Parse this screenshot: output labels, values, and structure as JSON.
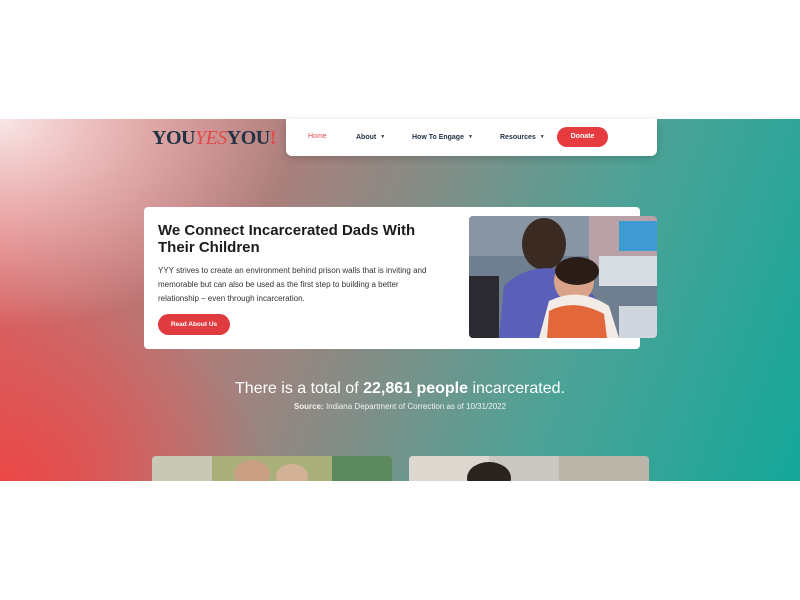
{
  "logo": {
    "you1": "YOU",
    "yes": "YES",
    "you2": "YOU",
    "excl": "!"
  },
  "nav": {
    "home": "Home",
    "about": "About",
    "engage": "How To Engage",
    "resources": "Resources",
    "donate": "Donate",
    "caret": "▼"
  },
  "hero": {
    "title": "We Connect Incarcerated Dads With Their Children",
    "text": "YYY strives to create an environment behind prison walls that is inviting and memorable but can also be used as the first step to building a better relationship – even through incarceration.",
    "button": "Read About Us"
  },
  "stat": {
    "prefix": "There is a total of ",
    "number": "22,861 people",
    "suffix": " incarcerated.",
    "source_label": "Source:",
    "source_text": " Indiana Department of Correction as of 10/31/2022"
  },
  "colors": {
    "accent": "#e63b3f",
    "navy": "#233344",
    "teal": "#14a89a"
  }
}
